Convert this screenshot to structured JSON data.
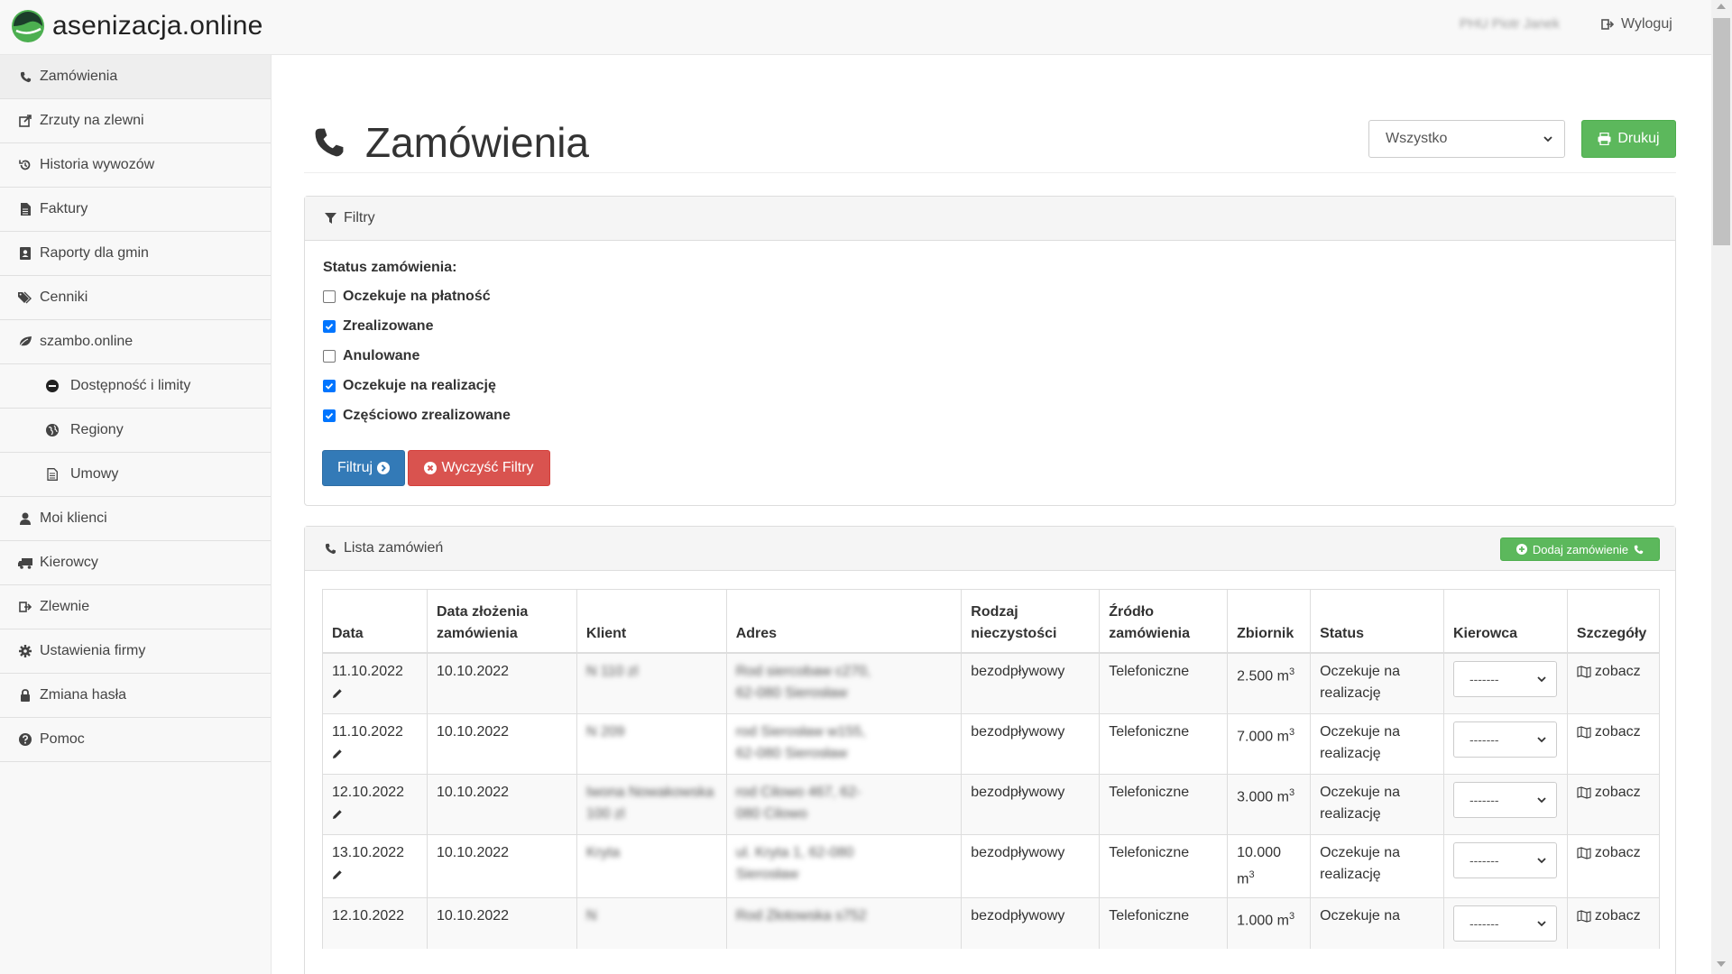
{
  "brand": {
    "name": "asenizacja.online"
  },
  "navbar": {
    "user": "PHU Piotr Janek",
    "logout": "Wyloguj"
  },
  "sidebar": {
    "items": [
      {
        "label": "Zamówienia",
        "icon": "phone-icon"
      },
      {
        "label": "Zrzuty na zlewni",
        "icon": "share-icon"
      },
      {
        "label": "Historia wywozów",
        "icon": "history-icon"
      },
      {
        "label": "Faktury",
        "icon": "file-icon"
      },
      {
        "label": "Raporty dla gmin",
        "icon": "address-book-icon"
      },
      {
        "label": "Cenniki",
        "icon": "tags-icon"
      },
      {
        "label": "szambo.online",
        "icon": "leaf-icon"
      },
      {
        "label": "Dostępność i limity",
        "icon": "minus-circle-icon"
      },
      {
        "label": "Regiony",
        "icon": "globe-icon"
      },
      {
        "label": "Umowy",
        "icon": "document-icon"
      },
      {
        "label": "Moi klienci",
        "icon": "user-icon"
      },
      {
        "label": "Kierowcy",
        "icon": "truck-icon"
      },
      {
        "label": "Zlewnie",
        "icon": "sign-out-icon"
      },
      {
        "label": "Ustawienia firmy",
        "icon": "cog-icon"
      },
      {
        "label": "Zmiana hasła",
        "icon": "lock-icon"
      },
      {
        "label": "Pomoc",
        "icon": "question-circle-icon"
      }
    ]
  },
  "header": {
    "title": "Zamówienia",
    "select_value": "Wszystko",
    "print_label": "Drukuj"
  },
  "filters": {
    "heading": "Filtry",
    "status_label": "Status zamówienia:",
    "options": [
      {
        "label": "Oczekuje na płatność",
        "checked": false
      },
      {
        "label": "Zrealizowane",
        "checked": true
      },
      {
        "label": "Anulowane",
        "checked": false
      },
      {
        "label": "Oczekuje na realizację",
        "checked": true
      },
      {
        "label": "Częściowo zrealizowane",
        "checked": true
      }
    ],
    "filter_button": "Filtruj",
    "clear_button": "Wyczyść Filtry"
  },
  "orders": {
    "heading": "Lista zamówień",
    "add_button": "Dodaj zamówienie",
    "columns": {
      "date": "Data",
      "created_l1": "Data złożenia",
      "created_l2": "zamówienia",
      "client": "Klient",
      "address": "Adres",
      "type_l1": "Rodzaj",
      "type_l2": "nieczystości",
      "source_l1": "Źródło",
      "source_l2": "zamówienia",
      "tank": "Zbiornik",
      "status": "Status",
      "driver": "Kierowca",
      "details": "Szczegóły"
    },
    "tank_unit": "m",
    "driver_placeholder": "-------",
    "details_link": "zobacz",
    "rows": [
      {
        "date": "11.10.2022",
        "created": "10.10.2022",
        "client": "N 110 zl",
        "address_l1": "Rod siercobaw c270,",
        "address_l2": "62-080 Sierosław",
        "type": "bezodpływowy",
        "source": "Telefoniczne",
        "tank": "2.500",
        "status_l1": "Oczekuje na",
        "status_l2": "realizację"
      },
      {
        "date": "11.10.2022",
        "created": "10.10.2022",
        "client": "N 209",
        "address_l1": "rod Sierosław w155,",
        "address_l2": "62-080 Sierosław",
        "type": "bezodpływowy",
        "source": "Telefoniczne",
        "tank": "7.000",
        "status_l1": "Oczekuje na",
        "status_l2": "realizację"
      },
      {
        "date": "12.10.2022",
        "created": "10.10.2022",
        "client": "Iwona Nowakowska 100 zl",
        "address_l1": "rod Cilowo 467, 62-",
        "address_l2": "080 Cilowo",
        "type": "bezodpływowy",
        "source": "Telefoniczne",
        "tank": "3.000",
        "status_l1": "Oczekuje na",
        "status_l2": "realizację"
      },
      {
        "date": "13.10.2022",
        "created": "10.10.2022",
        "client": "Kryta",
        "address_l1": "ul. Kryta 1, 62-080",
        "address_l2": "Sierosław",
        "type": "bezodpływowy",
        "source": "Telefoniczne",
        "tank": "10.000",
        "status_l1": "Oczekuje na",
        "status_l2": "realizację"
      },
      {
        "date": "12.10.2022",
        "created": "10.10.2022",
        "client": "N",
        "address_l1": "Rod Złotowska s752",
        "address_l2": "",
        "type": "bezodpływowy",
        "source": "Telefoniczne",
        "tank": "1.000",
        "status_l1": "Oczekuje na",
        "status_l2": ""
      }
    ]
  },
  "colors": {
    "green": "#5cb85c",
    "blue": "#337ab7",
    "red": "#d9534f",
    "checkbox": "#0075ff"
  }
}
